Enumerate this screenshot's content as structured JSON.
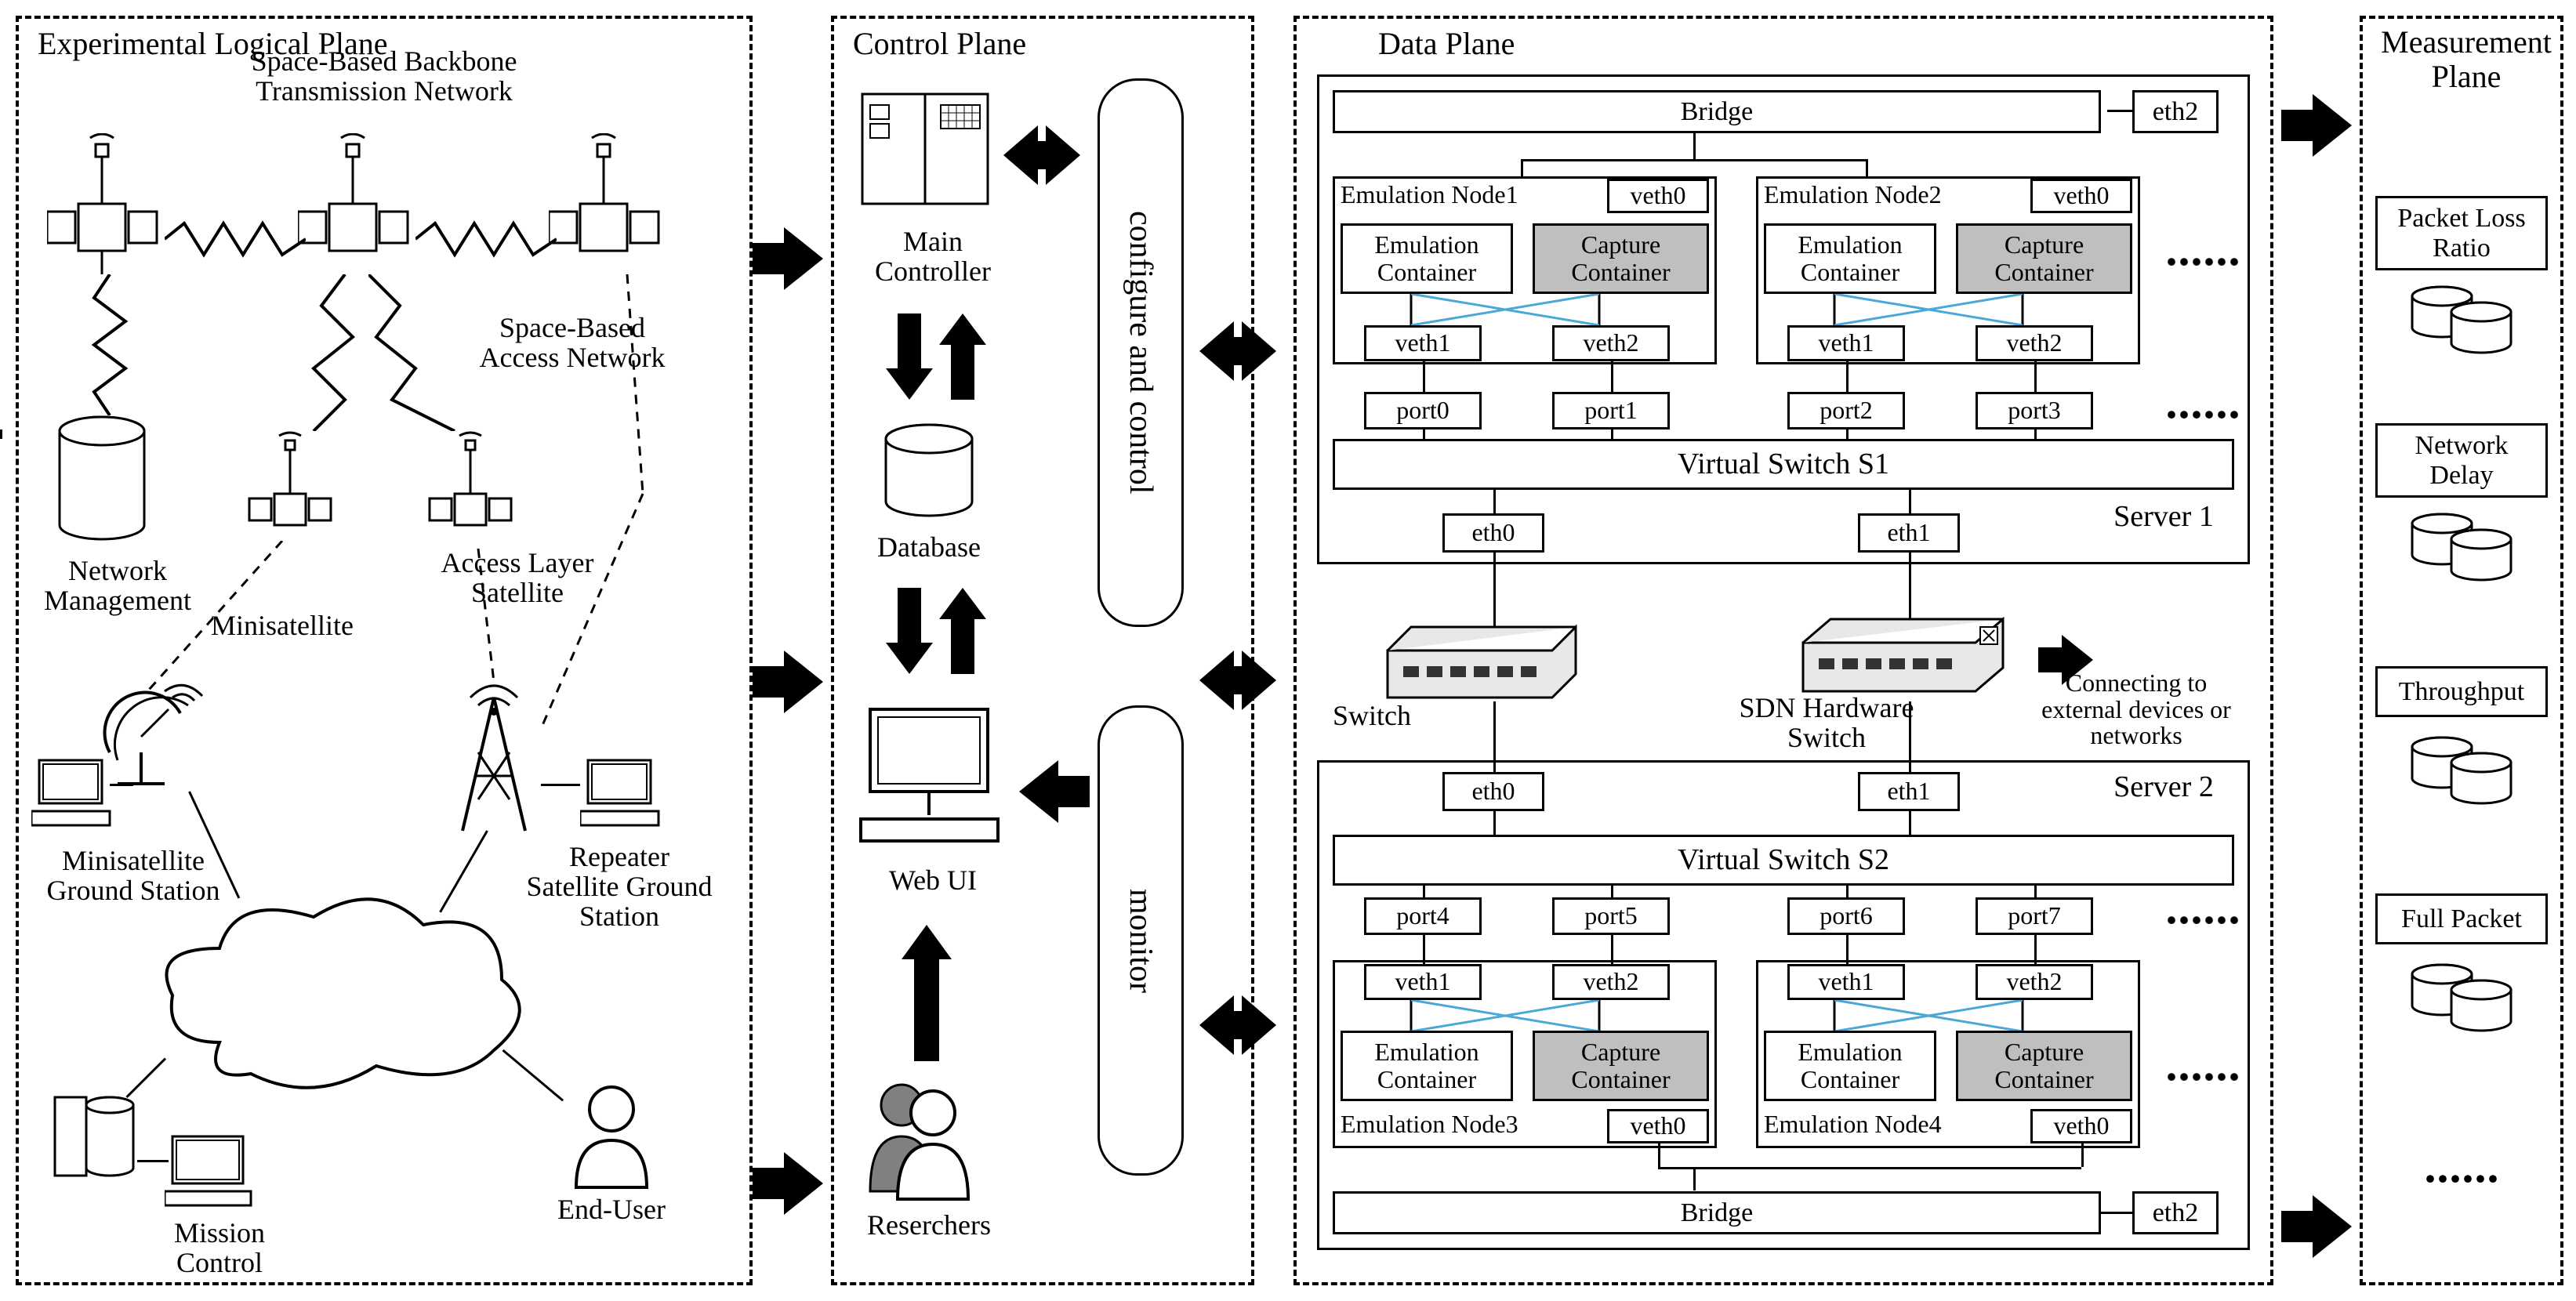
{
  "planes": {
    "exp": {
      "title": "Experimental Logical Plane"
    },
    "ctrl": {
      "title": "Control Plane"
    },
    "data": {
      "title": "Data Plane"
    },
    "meas": {
      "title": "Measurement Plane"
    }
  },
  "exp": {
    "backbone": "Space-Based Backbone\nTransmission Network",
    "access_net": "Space-Based\nAccess Network",
    "net_mgmt": "Network\nManagement",
    "minisat": "Minisatellite",
    "access_sat": "Access Layer\nSatellite",
    "minisat_gs": "Minisatellite\nGround Station",
    "repeater_gs": "Repeater\nSatellite Ground\nStation",
    "mission_ctrl": "Mission\nControl",
    "end_user": "End-User"
  },
  "ctrl": {
    "main_ctrl": "Main\nController",
    "database": "Database",
    "web_ui": "Web UI",
    "researchers": "Reserchers",
    "configure": "configure and control",
    "monitor": "monitor"
  },
  "data": {
    "bridge": "Bridge",
    "eth0": "eth0",
    "eth1": "eth1",
    "eth2": "eth2",
    "veth0": "veth0",
    "veth1": "veth1",
    "veth2": "veth2",
    "emu_container": "Emulation\nContainer",
    "cap_container": "Capture\nContainer",
    "emu_node1": "Emulation Node1",
    "emu_node2": "Emulation Node2",
    "emu_node3": "Emulation Node3",
    "emu_node4": "Emulation Node4",
    "port0": "port0",
    "port1": "port1",
    "port2": "port2",
    "port3": "port3",
    "port4": "port4",
    "port5": "port5",
    "port6": "port6",
    "port7": "port7",
    "vs1": "Virtual Switch S1",
    "vs2": "Virtual Switch S2",
    "server1": "Server 1",
    "server2": "Server 2",
    "switch": "Switch",
    "sdn_switch": "SDN Hardware\nSwitch",
    "ext_conn": "Connecting to\nexternal devices or\nnetworks"
  },
  "meas": {
    "plr": "Packet Loss\nRatio",
    "delay": "Network\nDelay",
    "throughput": "Throughput",
    "full_pkt": "Full Packet"
  }
}
